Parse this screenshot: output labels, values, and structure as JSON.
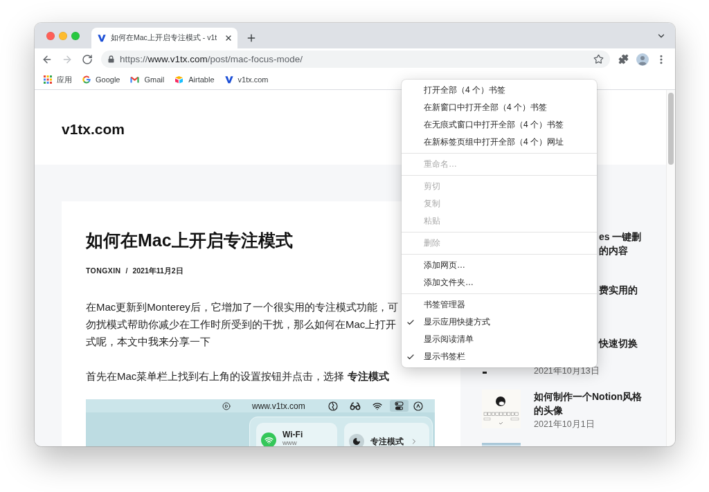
{
  "tabs": [
    {
      "title": "如何在Mac上开启专注模式 - v1t",
      "selected": true
    }
  ],
  "toolbar": {
    "nav": [
      {
        "kind": "back",
        "disabled": false
      },
      {
        "kind": "forward",
        "disabled": true
      },
      {
        "kind": "reload",
        "disabled": false
      }
    ],
    "url": {
      "scheme": "https://",
      "host": "www.v1tx.com",
      "path": "/post/mac-focus-mode/"
    }
  },
  "bookmarks_bar": [
    {
      "kind": "apps",
      "label": "应用"
    },
    {
      "kind": "google",
      "label": "Google"
    },
    {
      "kind": "gmail",
      "label": "Gmail"
    },
    {
      "kind": "airtable",
      "label": "Airtable"
    },
    {
      "kind": "site",
      "label": "v1tx.com"
    }
  ],
  "page": {
    "site_title": "v1tx.com",
    "article": {
      "title": "如何在Mac上开启专注模式",
      "author": "TONGXIN",
      "meta_separator": "/",
      "date": "2021年11月2日",
      "paragraphs": [
        {
          "lines": [
            "在Mac更新到Monterey后，它增加了一个很实用的专注模式功能，可",
            "勿扰模式帮助你减少在工作时所受到的干扰，那么如何在Mac上打开",
            "式呢，本文中我来分享一下"
          ]
        },
        {
          "lines": [
            "首先在Mac菜单栏上找到右上角的设置按钮并点击，选择 **专注模式**"
          ]
        }
      ],
      "screenshot": {
        "menu_bar_title": "www.v1tx.com",
        "tiles": [
          {
            "kind": "wifi",
            "title": "Wi-Fi",
            "subtitle": "www"
          },
          {
            "kind": "focus",
            "title": "专注模式"
          }
        ]
      }
    },
    "sidebar": {
      "covered_items": [
        {
          "title_lines": [
            "es 一键删",
            "的内容"
          ]
        },
        {
          "title_lines": [
            "费实用的"
          ]
        },
        {
          "title_lines": [
            "快速切换"
          ],
          "date": "2021年10月13日",
          "thumbnail": {
            "kind": "edge"
          }
        }
      ],
      "items": [
        {
          "title_lines": [
            "如何制作一个Notion风格",
            "的头像"
          ],
          "date": "2021年10月1日",
          "thumbnail": {
            "kind": "avatar-sketch"
          }
        },
        {
          "thumbnail": {
            "kind": "screenshot"
          }
        }
      ]
    }
  },
  "context_menu": {
    "groups": [
      {
        "items": [
          {
            "label": "打开全部（4 个）书签",
            "disabled": false,
            "checked": false
          },
          {
            "label": "在新窗口中打开全部（4 个）书签",
            "disabled": false,
            "checked": false
          },
          {
            "label": "在无痕式窗口中打开全部（4 个）书签",
            "disabled": false,
            "checked": false
          },
          {
            "label": "在新标签页组中打开全部（4 个）网址",
            "disabled": false,
            "checked": false
          }
        ]
      },
      {
        "items": [
          {
            "label": "重命名…",
            "disabled": true,
            "checked": false
          }
        ]
      },
      {
        "items": [
          {
            "label": "剪切",
            "disabled": true,
            "checked": false
          },
          {
            "label": "复制",
            "disabled": true,
            "checked": false
          },
          {
            "label": "粘贴",
            "disabled": true,
            "checked": false
          }
        ]
      },
      {
        "items": [
          {
            "label": "删除",
            "disabled": true,
            "checked": false
          }
        ]
      },
      {
        "items": [
          {
            "label": "添加网页…",
            "disabled": false,
            "checked": false
          },
          {
            "label": "添加文件夹…",
            "disabled": false,
            "checked": false
          }
        ]
      },
      {
        "items": [
          {
            "label": "书签管理器",
            "disabled": false,
            "checked": false
          },
          {
            "label": "显示应用快捷方式",
            "disabled": false,
            "checked": true
          },
          {
            "label": "显示阅读清单",
            "disabled": false,
            "checked": false
          },
          {
            "label": "显示书签栏",
            "disabled": false,
            "checked": true
          }
        ]
      }
    ]
  }
}
